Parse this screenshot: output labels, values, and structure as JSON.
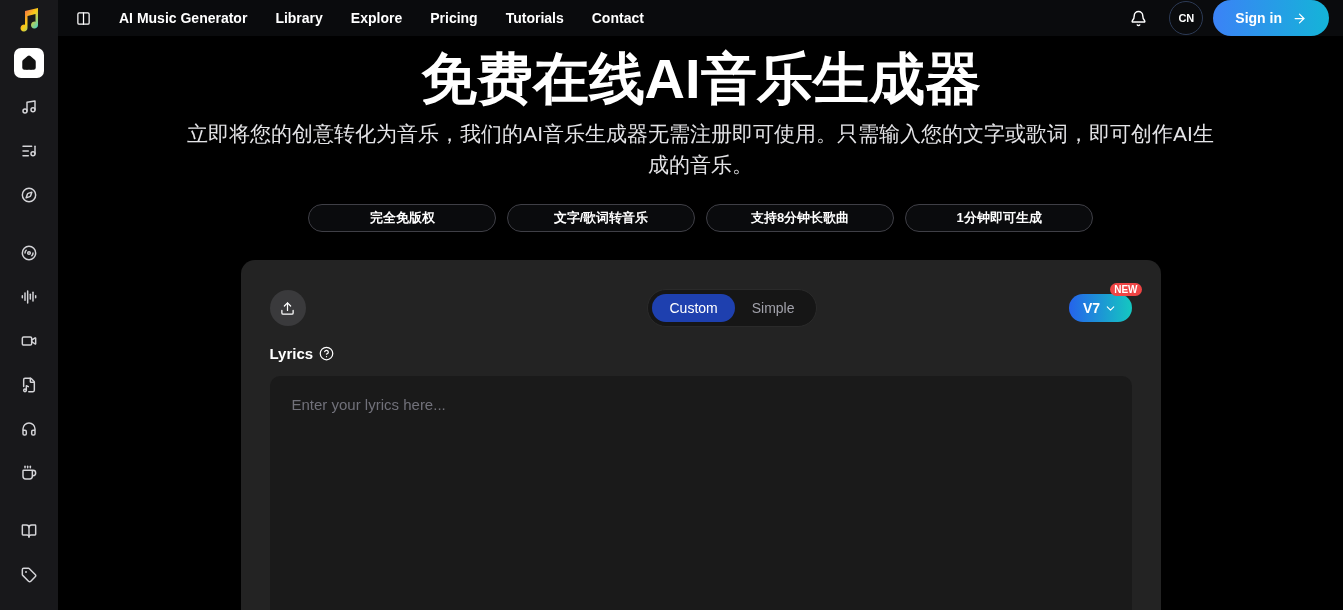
{
  "nav": {
    "links": [
      "AI Music Generator",
      "Library",
      "Explore",
      "Pricing",
      "Tutorials",
      "Contact"
    ],
    "language": "CN",
    "sign_in": "Sign in"
  },
  "sidebar": {
    "groups": [
      [
        {
          "selected": true
        },
        {
          "selected": false
        },
        {
          "selected": false
        },
        {
          "selected": false
        }
      ],
      [
        {
          "selected": false
        },
        {
          "selected": false
        },
        {
          "selected": false
        },
        {
          "selected": false
        },
        {
          "selected": false
        },
        {
          "selected": false
        }
      ],
      [
        {
          "selected": false
        },
        {
          "selected": false
        }
      ]
    ]
  },
  "hero": {
    "title": "免费在线AI音乐生成器",
    "subtitle": "立即将您的创意转化为音乐，我们的AI音乐生成器无需注册即可使用。只需输入您的文字或歌词，即可创作AI生成的音乐。",
    "features": [
      "完全免版权",
      "文字/歌词转音乐",
      "支持8分钟长歌曲",
      "1分钟即可生成"
    ]
  },
  "generator": {
    "modes": [
      {
        "label": "Custom",
        "selected": true
      },
      {
        "label": "Simple",
        "selected": false
      }
    ],
    "version": "V7",
    "version_badge": "NEW",
    "lyrics_label": "Lyrics",
    "lyrics": {
      "placeholder": "Enter your lyrics here..."
    }
  }
}
